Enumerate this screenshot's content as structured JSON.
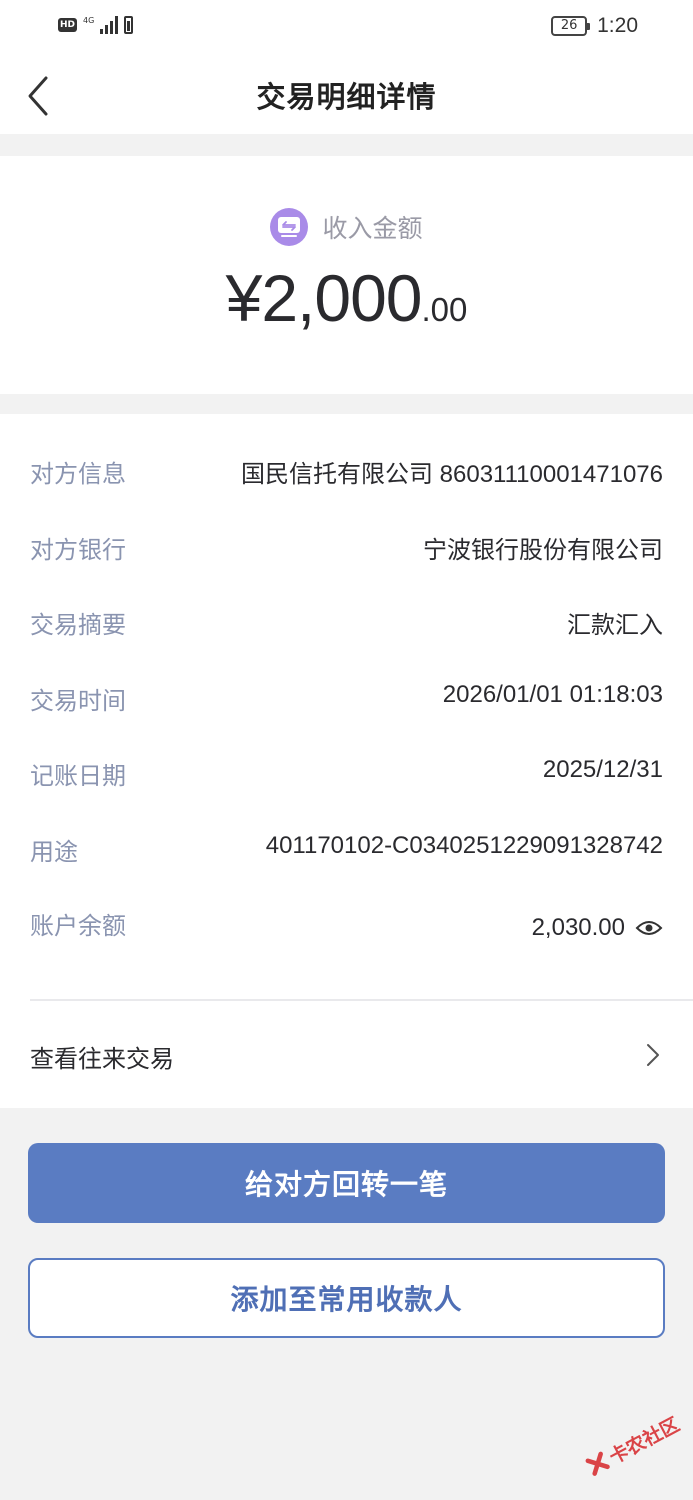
{
  "status_bar": {
    "hd": "HD",
    "network": "4G",
    "battery": "26",
    "time": "1:20"
  },
  "nav": {
    "title": "交易明细详情",
    "back_icon": "chevron-left-icon"
  },
  "amount": {
    "label": "收入金额",
    "main": "¥2,000",
    "decimal": ".00",
    "icon_color": "#a98be8"
  },
  "details": [
    {
      "label": "对方信息",
      "value": "国民信托有限公司 86031110001471076"
    },
    {
      "label": "对方银行",
      "value": "宁波银行股份有限公司"
    },
    {
      "label": "交易摘要",
      "value": "汇款汇入"
    },
    {
      "label": "交易时间",
      "value": "2026/01/01 01:18:03"
    },
    {
      "label": "记账日期",
      "value": "2025/12/31"
    },
    {
      "label": "用途",
      "value": "401170102-C034025122909132874​2"
    },
    {
      "label": "账户余额",
      "value": "2,030.00"
    }
  ],
  "history": {
    "label": "查看往来交易"
  },
  "buttons": {
    "primary": "给对方回转一笔",
    "secondary": "添加至常用收款人"
  },
  "watermark": {
    "text": "卡农社区"
  },
  "colors": {
    "accent": "#5a7cc2",
    "label_gray": "#8a94b0",
    "background": "#f2f2f2"
  }
}
